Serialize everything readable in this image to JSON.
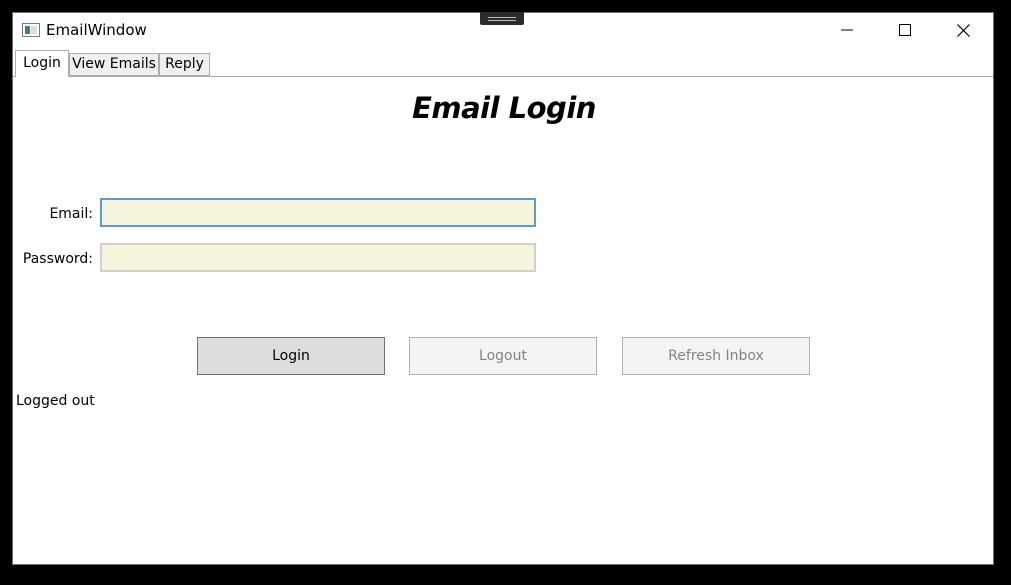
{
  "window": {
    "title": "EmailWindow"
  },
  "tabs": [
    {
      "label": "Login",
      "active": true
    },
    {
      "label": "View Emails",
      "active": false
    },
    {
      "label": "Reply",
      "active": false
    }
  ],
  "login": {
    "heading": "Email Login",
    "email_label": "Email:",
    "email_value": "",
    "password_label": "Password:",
    "password_value": "",
    "field_background": "#f5f5dc",
    "focus_color": "#5a9bd5"
  },
  "buttons": {
    "login_label": "Login",
    "logout_label": "Logout",
    "refresh_label": "Refresh Inbox"
  },
  "status": {
    "text": "Logged out"
  },
  "icons": {
    "app": "window-app-icon",
    "minimize": "minimize-icon",
    "maximize": "maximize-icon",
    "close": "close-icon"
  }
}
